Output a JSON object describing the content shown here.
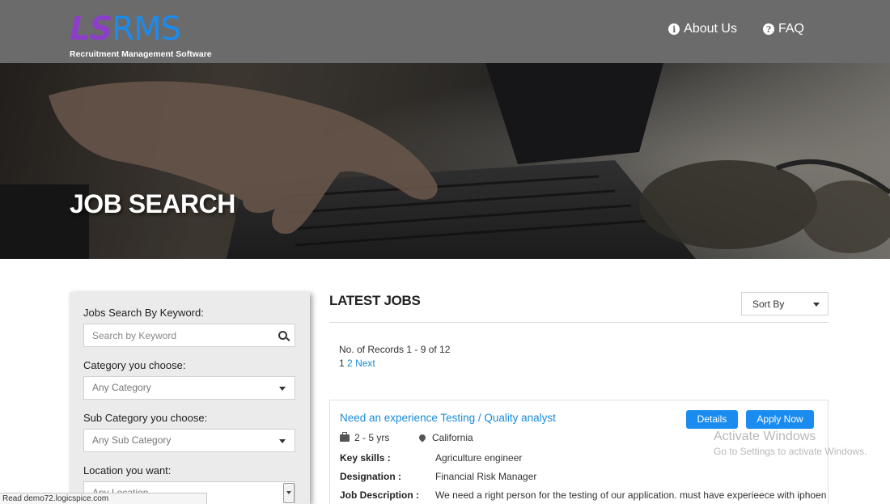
{
  "header": {
    "logo_mark_ls": "LS",
    "logo_mark_rms": "RMS",
    "logo_tagline": "Recruitment Management Software",
    "nav": [
      {
        "label": "About Us",
        "icon": "info-icon"
      },
      {
        "label": "FAQ",
        "icon": "question-icon"
      }
    ]
  },
  "hero": {
    "title": "JOB SEARCH"
  },
  "sidebar": {
    "keyword_label": "Jobs Search By Keyword:",
    "keyword_placeholder": "Search by Keyword",
    "category_label": "Category you choose:",
    "category_value": "Any Category",
    "subcategory_label": "Sub Category you choose:",
    "subcategory_value": "Any Sub Category",
    "location_label": "Location you want:",
    "location_value": "Any Location"
  },
  "main": {
    "title": "LATEST JOBS",
    "sort_label": "Sort By",
    "records_text": "No. of Records 1 - 9 of 12",
    "pager": {
      "current": "1",
      "page2": "2",
      "next": "Next"
    },
    "jobs": [
      {
        "title": "Need an experience Testing / Quality analyst",
        "details_label": "Details",
        "apply_label": "Apply Now",
        "experience": "2 - 5 yrs",
        "location": "California",
        "key_skills_label": "Key skills :",
        "key_skills": "Agriculture engineer",
        "designation_label": "Designation :",
        "designation": "Financial Risk Manager",
        "description_label": "Job Description :",
        "description": "We need a right person for the testing of our application. must have experieece with iphoen"
      }
    ]
  },
  "watermark": {
    "line1": "Activate Windows",
    "line2": "Go to Settings to activate Windows."
  },
  "statusbar": {
    "text": "Read demo72.logicspice.com"
  },
  "colors": {
    "accent": "#1a8cf0",
    "header_bg": "#6b6b6b",
    "logo_purple": "#8b3fc9"
  }
}
